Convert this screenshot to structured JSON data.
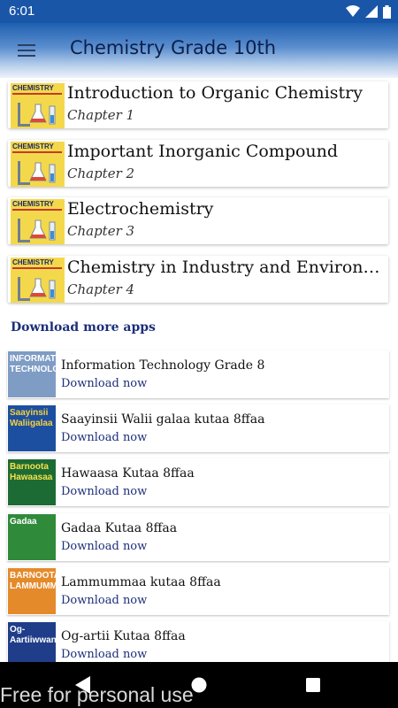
{
  "status_bar": {
    "time": "6:01",
    "icons": [
      "wifi-icon",
      "signal-icon",
      "battery-icon"
    ]
  },
  "app_bar": {
    "title": "Chemistry Grade 10th",
    "menu_icon": "menu-icon"
  },
  "chapters": [
    {
      "title": "Introduction to Organic Chemistry",
      "subtitle": "Chapter 1",
      "thumb_label": "CHEMISTRY"
    },
    {
      "title": "Important Inorganic Compound",
      "subtitle": "Chapter 2",
      "thumb_label": "CHEMISTRY"
    },
    {
      "title": "Electrochemistry",
      "subtitle": "Chapter 3",
      "thumb_label": "CHEMISTRY"
    },
    {
      "title": "Chemistry in Industry and Environment",
      "subtitle": "Chapter 4",
      "thumb_label": "CHEMISTRY"
    }
  ],
  "more_apps_heading": "Download more apps",
  "apps": [
    {
      "name": "Information Technology Grade 8",
      "link": "Download now",
      "thumb_text": "INFORMATION TECHNOLOGY",
      "thumb_bg": "#7e9cc4",
      "thumb_fg": "#ffffff"
    },
    {
      "name": "Saayinsii Walii galaa kutaa 8ffaa",
      "link": "Download now",
      "thumb_text": "Saayinsii Waliigalaa",
      "thumb_bg": "#1d4fa0",
      "thumb_fg": "#f6d23a"
    },
    {
      "name": "Hawaasa Kutaa 8ffaa",
      "link": "Download now",
      "thumb_text": "Barnoota Hawaasaa",
      "thumb_bg": "#1d6b34",
      "thumb_fg": "#f6e04a"
    },
    {
      "name": "Gadaa Kutaa 8ffaa",
      "link": "Download now",
      "thumb_text": "Gadaa",
      "thumb_bg": "#2f8a3a",
      "thumb_fg": "#ffffff"
    },
    {
      "name": "Lammummaa kutaa 8ffaa",
      "link": "Download now",
      "thumb_text": "BARNOOTA LAMMUMMAA",
      "thumb_bg": "#e58a2a",
      "thumb_fg": "#ffffff"
    },
    {
      "name": "Og-artii Kutaa 8ffaa",
      "link": "Download now",
      "thumb_text": "Og-Aartiiwwan",
      "thumb_bg": "#203d8a",
      "thumb_fg": "#ffffff"
    }
  ],
  "nav_bar": {
    "back_icon": "back-triangle-icon",
    "home_icon": "home-circle-icon",
    "recents_icon": "recents-square-icon"
  },
  "watermark": "Free for personal use",
  "colors": {
    "status_bar": "#1a56a8",
    "link": "#1c2f7a",
    "thumb_yellow": "#f4d84c"
  }
}
